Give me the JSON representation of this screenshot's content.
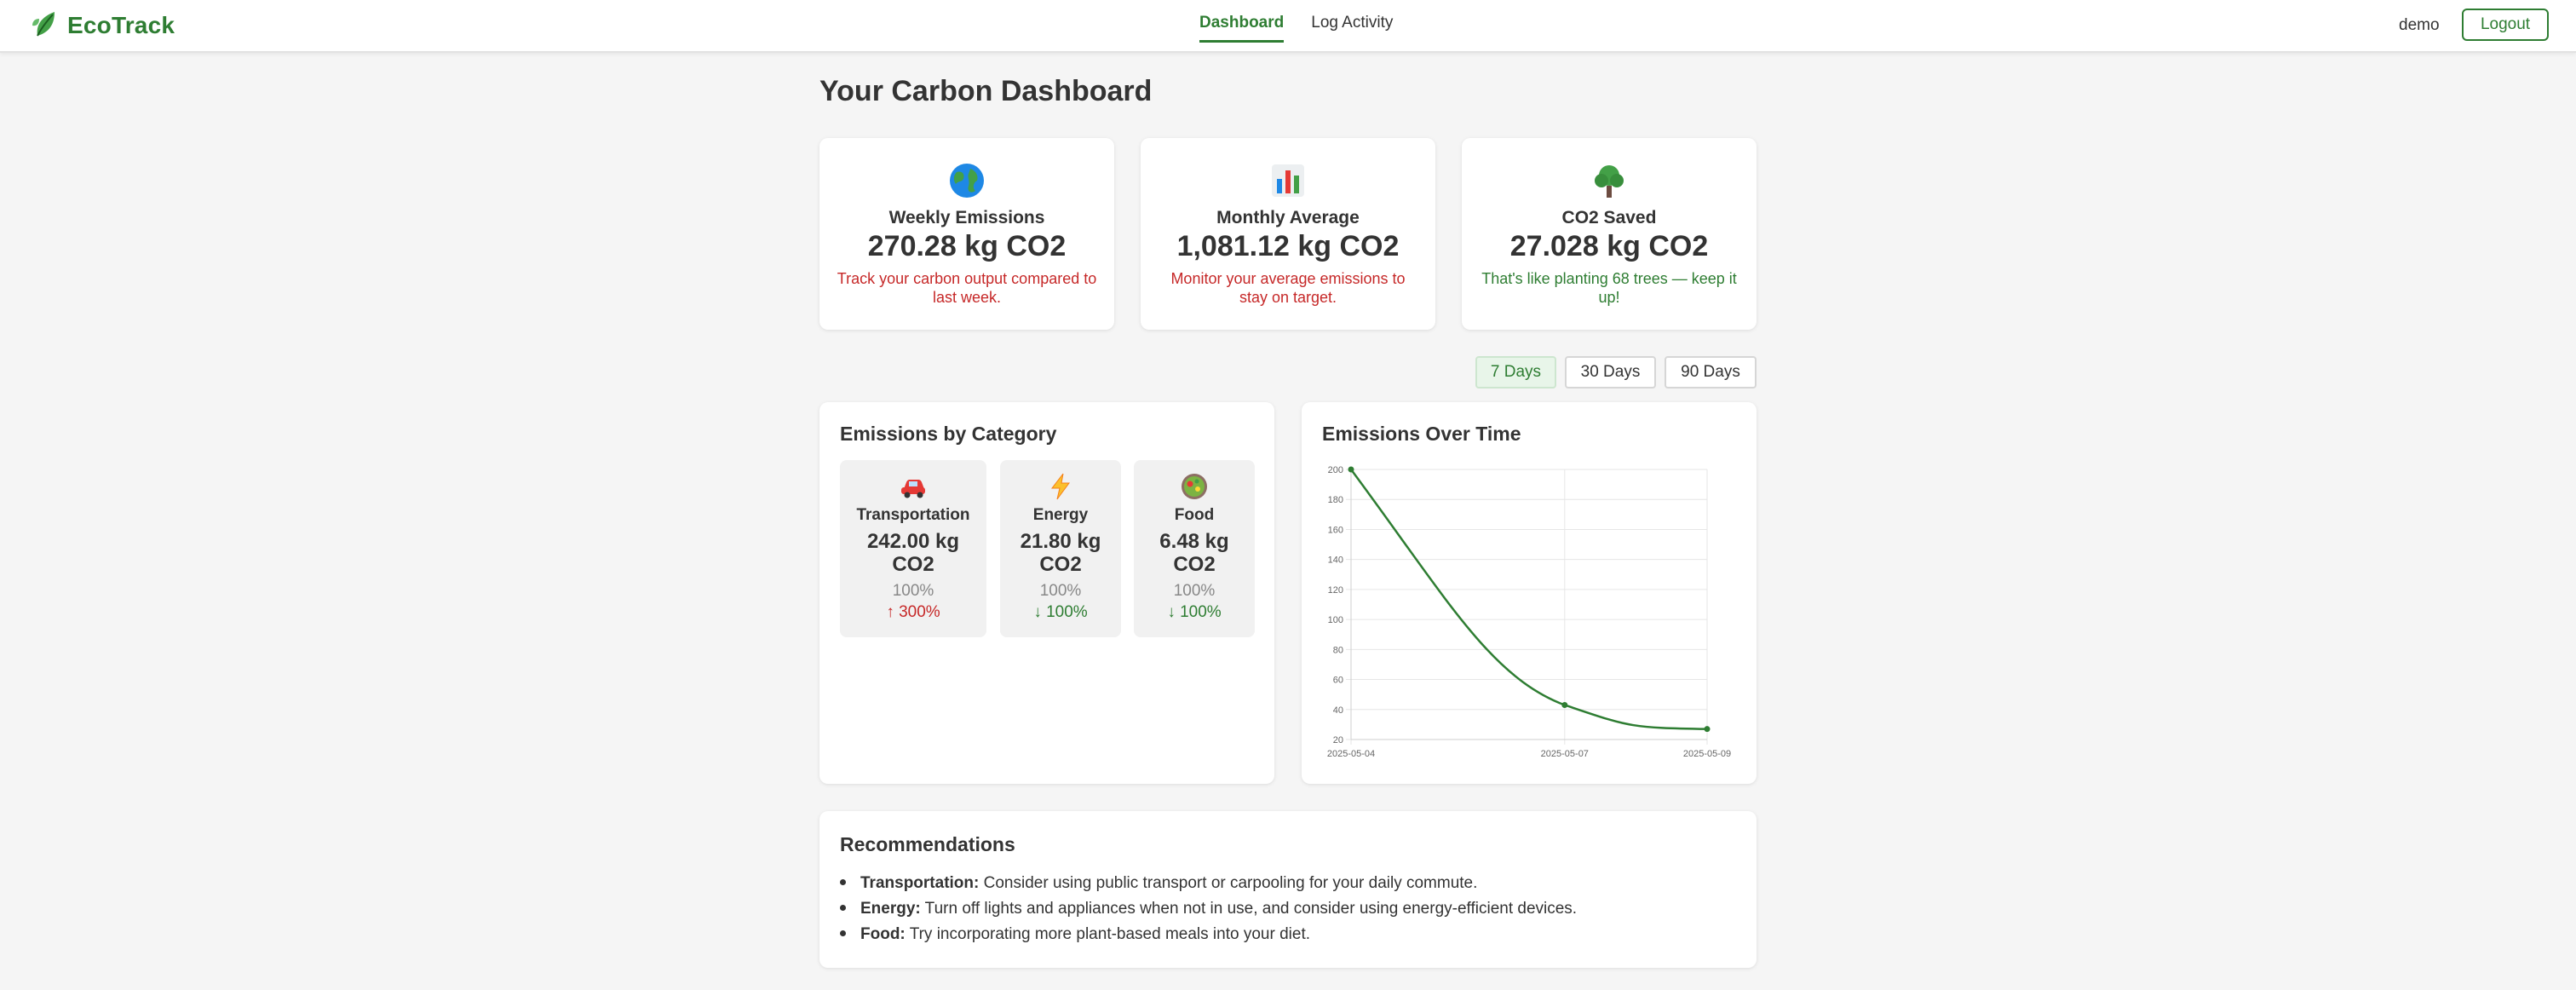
{
  "header": {
    "brand": "EcoTrack",
    "nav": [
      {
        "label": "Dashboard",
        "active": true
      },
      {
        "label": "Log Activity",
        "active": false
      }
    ],
    "user": "demo",
    "logout_label": "Logout"
  },
  "page_title": "Your Carbon Dashboard",
  "stats": [
    {
      "icon": "globe-icon",
      "label": "Weekly Emissions",
      "value": "270.28 kg CO2",
      "note": "Track your carbon output compared to last week.",
      "note_color": "#c62828"
    },
    {
      "icon": "bar-chart-icon",
      "label": "Monthly Average",
      "value": "1,081.12 kg CO2",
      "note": "Monitor your average emissions to stay on target.",
      "note_color": "#c62828"
    },
    {
      "icon": "tree-icon",
      "label": "CO2 Saved",
      "value": "27.028 kg CO2",
      "note": "That's like planting 68 trees — keep it up!",
      "note_color": "#2e7d32"
    }
  ],
  "ranges": [
    {
      "label": "7 Days",
      "active": true
    },
    {
      "label": "30 Days",
      "active": false
    },
    {
      "label": "90 Days",
      "active": false
    }
  ],
  "category_panel": {
    "title": "Emissions by Category",
    "categories": [
      {
        "icon": "car-icon",
        "name": "Transportation",
        "value": "242.00 kg CO2",
        "share": "100%",
        "change": "↑ 300%",
        "direction": "up"
      },
      {
        "icon": "lightning-icon",
        "name": "Energy",
        "value": "21.80 kg CO2",
        "share": "100%",
        "change": "↓ 100%",
        "direction": "down"
      },
      {
        "icon": "salad-icon",
        "name": "Food",
        "value": "6.48 kg CO2",
        "share": "100%",
        "change": "↓ 100%",
        "direction": "down"
      }
    ]
  },
  "chart_panel": {
    "title": "Emissions Over Time"
  },
  "chart_data": {
    "type": "line",
    "x": [
      "2025-05-04",
      "2025-05-07",
      "2025-05-09"
    ],
    "series": [
      {
        "values": [
          200,
          43,
          27
        ],
        "color": "#2e7d32"
      }
    ],
    "ylim": [
      20,
      200
    ],
    "yticks": [
      20,
      40,
      60,
      80,
      100,
      120,
      140,
      160,
      180,
      200
    ],
    "xlabel": "",
    "ylabel": "",
    "grid": true
  },
  "recommendations": {
    "title": "Recommendations",
    "items": [
      {
        "category": "Transportation:",
        "text": " Consider using public transport or carpooling for your daily commute."
      },
      {
        "category": "Energy:",
        "text": " Turn off lights and appliances when not in use, and consider using energy-efficient devices."
      },
      {
        "category": "Food:",
        "text": " Try incorporating more plant-based meals into your diet."
      }
    ]
  }
}
